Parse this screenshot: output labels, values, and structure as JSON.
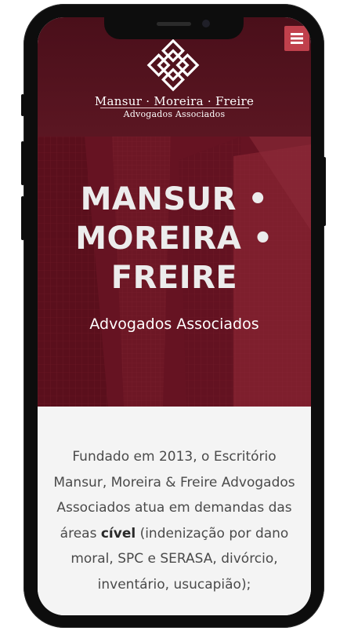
{
  "header": {
    "menu_icon": "hamburger-menu-icon",
    "logo_icon": "interlocking-squares-logo-icon",
    "logo_name": "Mansur · Moreira · Freire",
    "logo_subtitle": "Advogados Associados",
    "brand_color": "#5b1622",
    "menu_color": "#c0404c"
  },
  "hero": {
    "title_line1": "MANSUR •",
    "title_line2": "MOREIRA •",
    "title_line3": "FREIRE",
    "subtitle": "Advogados Associados",
    "background": "red-tinted skyscrapers photo"
  },
  "intro": {
    "text_before": "Fundado em 2013, o Escritório Mansur, Moreira & Freire Advogados Associados atua em demandas das áreas ",
    "text_bold": "cível",
    "text_after": " (indenização por dano moral, SPC e SERASA, divórcio, inventário, usucapião);"
  }
}
